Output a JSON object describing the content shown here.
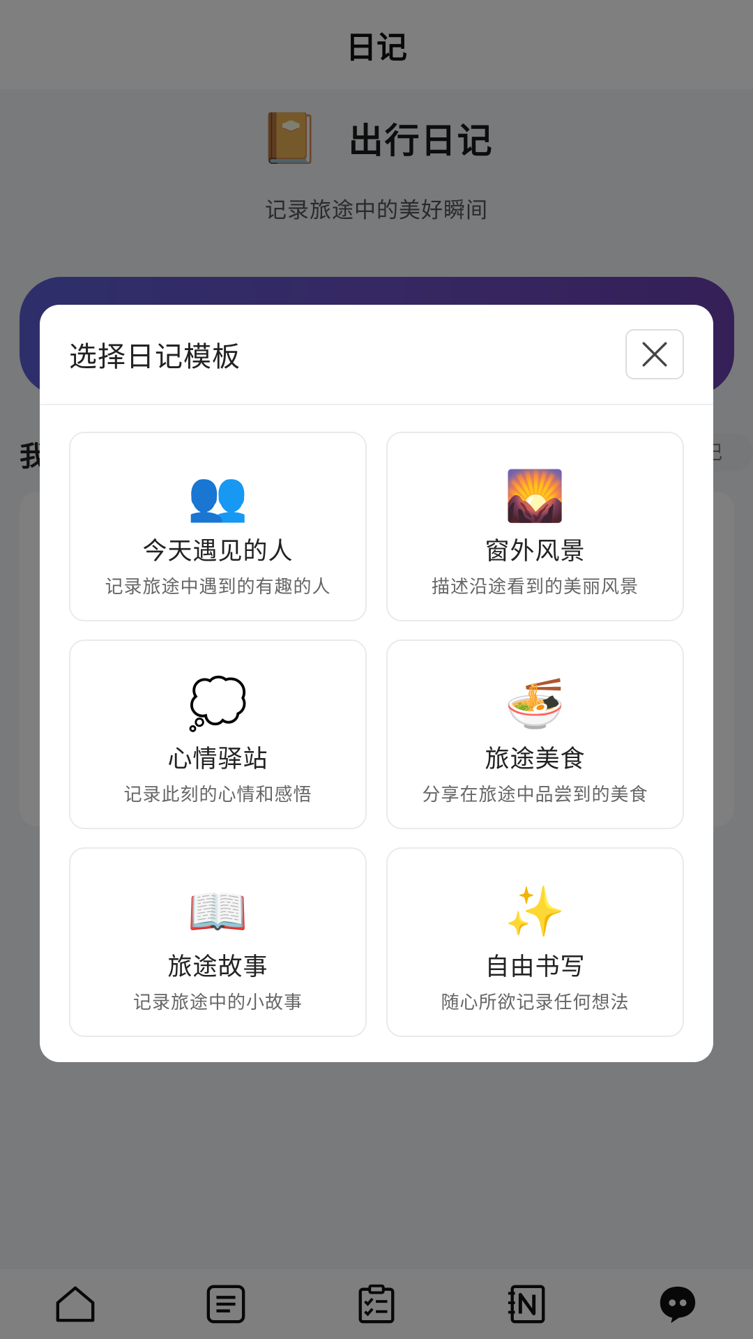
{
  "app": {
    "title": "日记"
  },
  "hero": {
    "icon": "📔",
    "title": "出行日记",
    "subtitle": "记录旅途中的美好瞬间"
  },
  "section": {
    "heading": "我",
    "pill": "记"
  },
  "modal": {
    "title": "选择日记模板",
    "close_icon": "close-icon",
    "templates": [
      {
        "icon": "👥",
        "title": "今天遇见的人",
        "desc": "记录旅途中遇到的有趣的人"
      },
      {
        "icon": "🌄",
        "title": "窗外风景",
        "desc": "描述沿途看到的美丽风景"
      },
      {
        "icon": "💭",
        "title": "心情驿站",
        "desc": "记录此刻的心情和感悟"
      },
      {
        "icon": "🍜",
        "title": "旅途美食",
        "desc": "分享在旅途中品尝到的美食"
      },
      {
        "icon": "📖",
        "title": "旅途故事",
        "desc": "记录旅途中的小故事"
      },
      {
        "icon": "✨",
        "title": "自由书写",
        "desc": "随心所欲记录任何想法"
      }
    ]
  },
  "tabbar": {
    "icons": [
      "home-icon",
      "list-icon",
      "checklist-icon",
      "notebook-icon",
      "chat-icon"
    ]
  },
  "colors": {
    "banner_start": "#5b5fd6",
    "banner_end": "#6a3fb0",
    "overlay": "rgba(0,0,0,0.5)"
  }
}
